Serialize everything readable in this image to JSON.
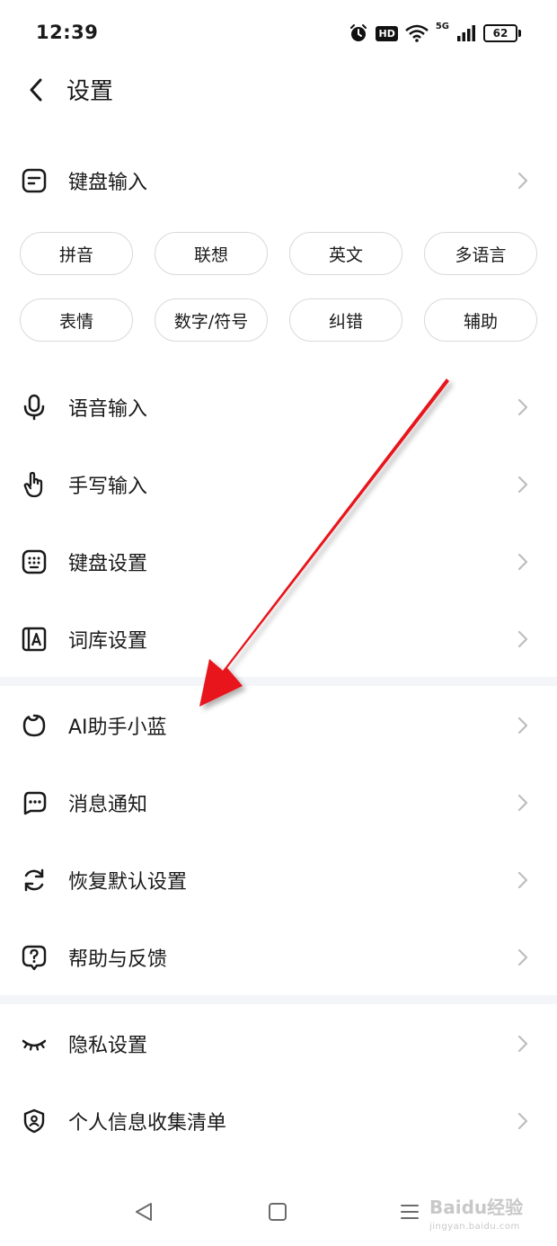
{
  "status_bar": {
    "time": "12:39",
    "hd": "HD",
    "network": "5G",
    "battery": "62"
  },
  "header": {
    "title": "设置",
    "back_icon": "chevron-left-icon"
  },
  "sections": {
    "keyboard_input": {
      "label": "键盘输入",
      "icon": "keyboard-input-icon"
    },
    "chips_row1": [
      "拼音",
      "联想",
      "英文",
      "多语言"
    ],
    "chips_row2": [
      "表情",
      "数字/符号",
      "纠错",
      "辅助"
    ],
    "voice_input": {
      "label": "语音输入",
      "icon": "microphone-icon"
    },
    "handwriting_input": {
      "label": "手写输入",
      "icon": "hand-pointer-icon"
    },
    "keyboard_settings": {
      "label": "键盘设置",
      "icon": "keyboard-icon"
    },
    "lexicon_settings": {
      "label": "词库设置",
      "icon": "dictionary-icon"
    },
    "ai_assistant": {
      "label": "AI助手小蓝",
      "icon": "ai-assistant-icon"
    },
    "notifications": {
      "label": "消息通知",
      "icon": "message-icon"
    },
    "restore_defaults": {
      "label": "恢复默认设置",
      "icon": "refresh-icon"
    },
    "help_feedback": {
      "label": "帮助与反馈",
      "icon": "question-icon"
    },
    "privacy_settings": {
      "label": "隐私设置",
      "icon": "eye-closed-icon"
    },
    "personal_info": {
      "label": "个人信息收集清单",
      "icon": "shield-user-icon"
    }
  },
  "nav_bar": {
    "icons": [
      "back-triangle-icon",
      "home-square-icon",
      "menu-lines-icon"
    ]
  },
  "watermark": {
    "text": "Baidu经验",
    "subtext": "jingyan.baidu.com"
  },
  "colors": {
    "accent_arrow": "#e8121a",
    "divider": "#f3f5f8",
    "chevron": "#bdbdbd",
    "chip_border": "#d9d9d9"
  }
}
